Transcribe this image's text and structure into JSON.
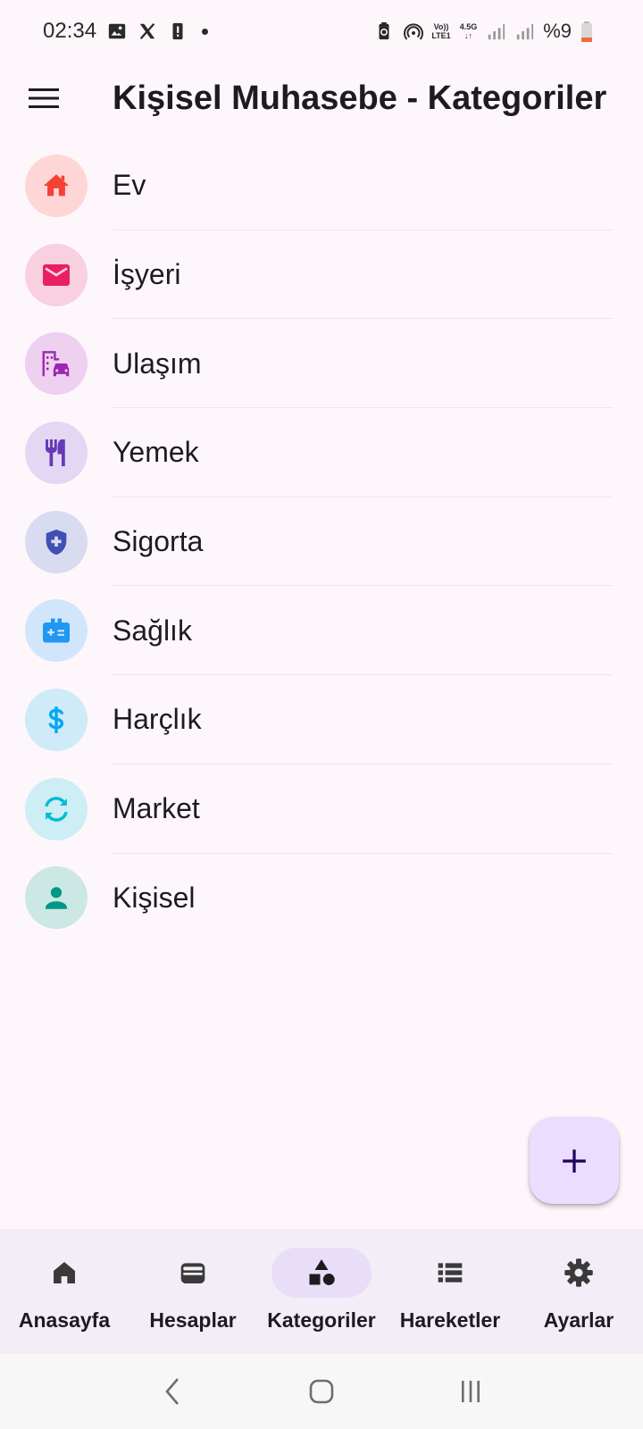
{
  "status_bar": {
    "time": "02:34",
    "battery": "%9",
    "volte_label": "Vo))",
    "lte_label": "LTE1",
    "network_label": "4.5G"
  },
  "app_bar": {
    "title": "Kişisel Muhasebe - Kategoriler",
    "menu_icon": "hamburger-menu-icon"
  },
  "categories": [
    {
      "label": "Ev",
      "icon": "home-icon",
      "color": "#F44336",
      "bg": "#FFD6D6"
    },
    {
      "label": "İşyeri",
      "icon": "mail-icon",
      "color": "#E91E63",
      "bg": "#F9D0E0"
    },
    {
      "label": "Ulaşım",
      "icon": "commute-icon",
      "color": "#9C27B0",
      "bg": "#EED0F0"
    },
    {
      "label": "Yemek",
      "icon": "restaurant-icon",
      "color": "#673AB7",
      "bg": "#E3D7F3"
    },
    {
      "label": "Sigorta",
      "icon": "shield-plus-icon",
      "color": "#3F51B5",
      "bg": "#D9DBF1"
    },
    {
      "label": "Sağlık",
      "icon": "medical-kit-icon",
      "color": "#2196F3",
      "bg": "#D2E6FB"
    },
    {
      "label": "Harçlık",
      "icon": "dollar-icon",
      "color": "#03A9F4",
      "bg": "#CFEAF9"
    },
    {
      "label": "Market",
      "icon": "sync-icon",
      "color": "#00BCD4",
      "bg": "#CDEEF4"
    },
    {
      "label": "Kişisel",
      "icon": "person-icon",
      "color": "#009688",
      "bg": "#CBE8E4"
    }
  ],
  "fab": {
    "icon": "plus-icon"
  },
  "bottom_nav": [
    {
      "label": "Anasayfa",
      "icon": "home-icon",
      "active": false
    },
    {
      "label": "Hesaplar",
      "icon": "wallet-icon",
      "active": false
    },
    {
      "label": "Kategoriler",
      "icon": "category-shapes-icon",
      "active": true
    },
    {
      "label": "Hareketler",
      "icon": "list-icon",
      "active": false
    },
    {
      "label": "Ayarlar",
      "icon": "gear-icon",
      "active": false
    }
  ],
  "system_nav": {
    "back": "back-icon",
    "home": "home-circle-icon",
    "recents": "recents-icon"
  }
}
